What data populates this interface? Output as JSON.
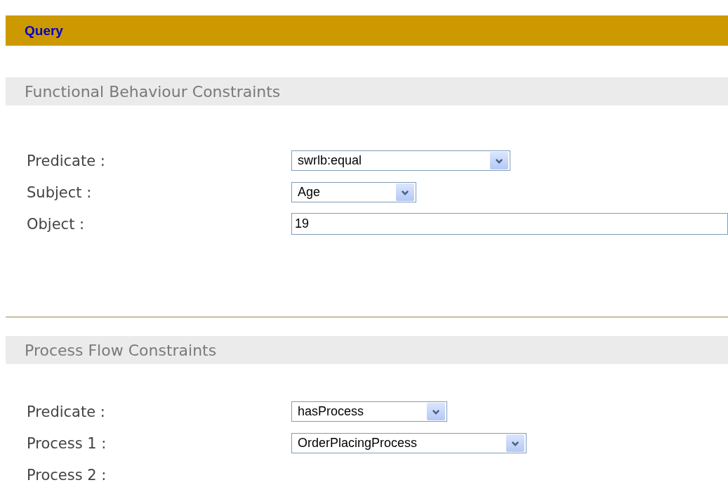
{
  "header": {
    "title": "Query"
  },
  "sections": [
    {
      "title": "Functional Behaviour Constraints",
      "rows": [
        {
          "label": "Predicate :",
          "kind": "select",
          "value": "swrlb:equal"
        },
        {
          "label": "Subject :",
          "kind": "select",
          "value": "Age"
        },
        {
          "label": "Object :",
          "kind": "text",
          "value": "19"
        }
      ]
    },
    {
      "title": "Process Flow Constraints",
      "rows": [
        {
          "label": "Predicate :",
          "kind": "select",
          "value": "hasProcess"
        },
        {
          "label": "Process 1 :",
          "kind": "select",
          "value": "OrderPlacingProcess"
        },
        {
          "label": "Process 2 :",
          "kind": "empty"
        }
      ]
    }
  ]
}
